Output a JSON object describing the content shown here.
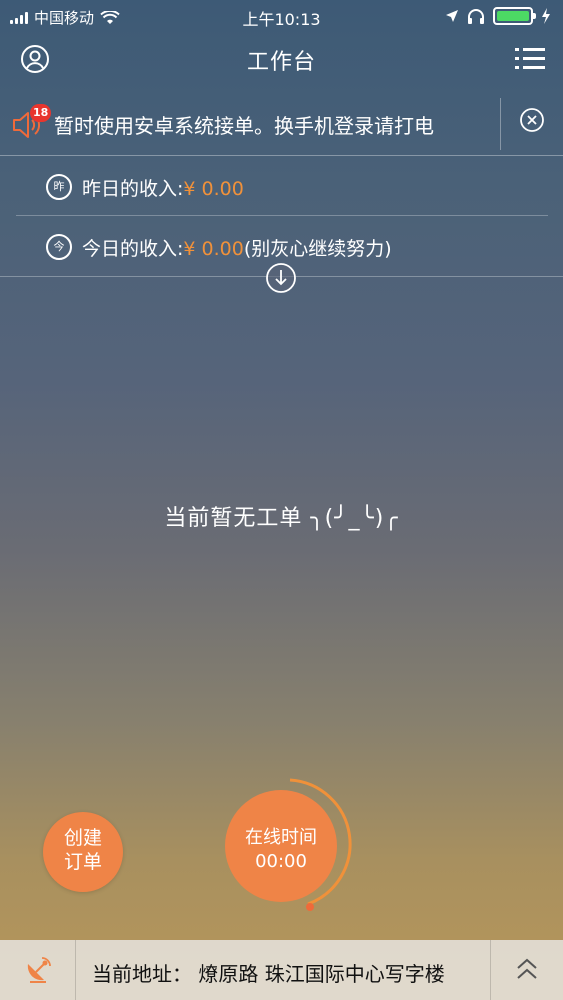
{
  "status_bar": {
    "carrier": "中国移动",
    "time": "上午10:13",
    "battery_color": "#4cd964"
  },
  "header": {
    "title": "工作台",
    "left_icon": "user-icon",
    "right_icon": "list-menu-icon"
  },
  "notice": {
    "badge": "18",
    "text": "暂时使用安卓系统接单。换手机登录请打电"
  },
  "income": {
    "yesterday": {
      "icon_text": "昨",
      "label": "昨日的收入:",
      "amount": "¥ 0.00",
      "note": ""
    },
    "today": {
      "icon_text": "今",
      "label": "今日的收入:",
      "amount": "¥ 0.00",
      "note": "(别灰心继续努力)"
    }
  },
  "empty_state": "当前暂无工单 ╮(╯_╰)╭",
  "buttons": {
    "create_order_line1": "创建",
    "create_order_line2": "订单",
    "online_label": "在线时间",
    "online_time": "00:00"
  },
  "bottom_bar": {
    "address": "当前地址： 燎原路 珠江国际中心写字楼"
  },
  "colors": {
    "accent": "#ef8447",
    "money": "#f0913a",
    "badge": "#e8352e"
  }
}
